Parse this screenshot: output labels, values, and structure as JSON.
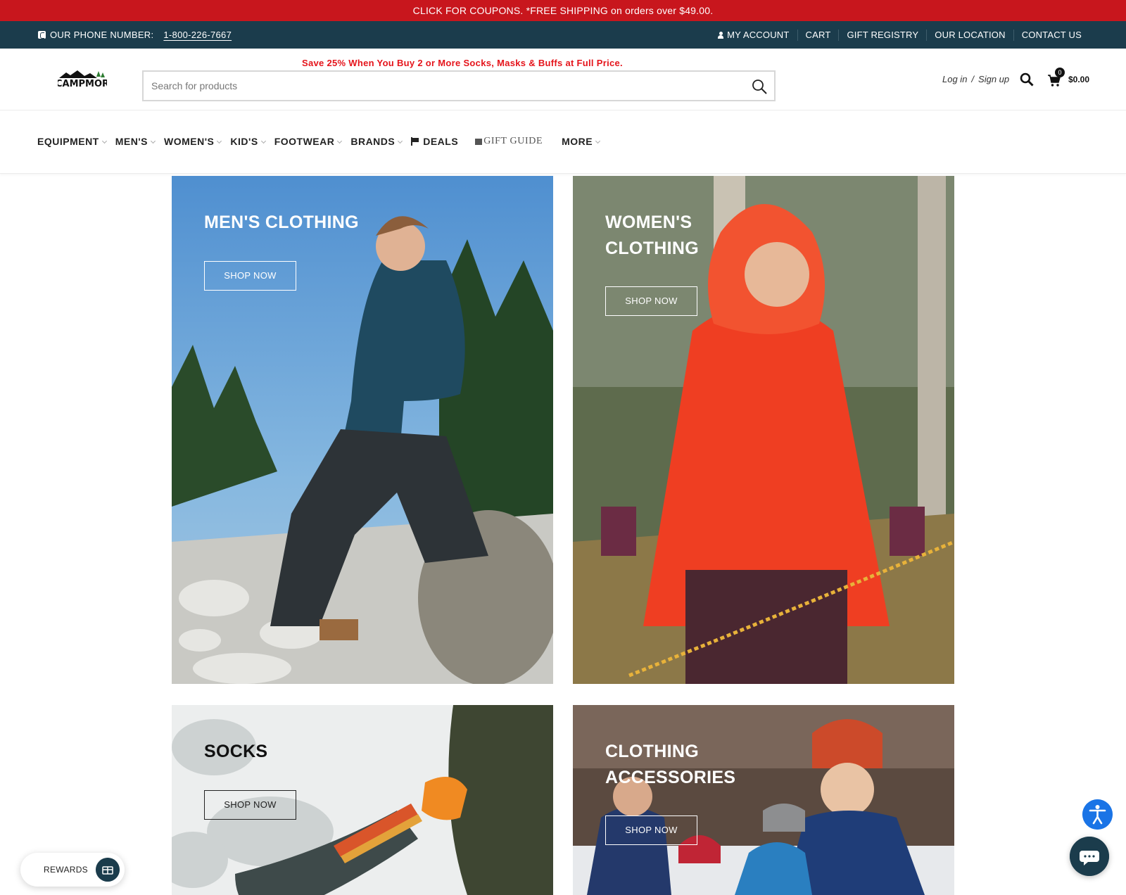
{
  "coupon_bar": {
    "text": "CLICK FOR COUPONS. *FREE SHIPPING on orders over $49.00."
  },
  "utility_bar": {
    "phone_label": "OUR PHONE NUMBER:",
    "phone_number": "1-800-226-7667",
    "links": [
      "MY ACCOUNT",
      "CART",
      "GIFT REGISTRY",
      "OUR LOCATION",
      "CONTACT US"
    ]
  },
  "header": {
    "logo_text": "CAMPMOR",
    "promo": "Save 25% When You Buy 2 or More Socks, Masks & Buffs at Full Price.",
    "search_placeholder": "Search for products",
    "login": "Log in",
    "auth_separator": "/",
    "signup": "Sign up",
    "cart_count": "0",
    "cart_total": "$0.00"
  },
  "nav": {
    "items": [
      "EQUIPMENT",
      "MEN'S",
      "WOMEN'S",
      "KID'S",
      "FOOTWEAR",
      "BRANDS",
      "DEALS",
      "GIFT GUIDE",
      "MORE"
    ]
  },
  "tiles": [
    {
      "title": "MEN'S CLOTHING",
      "button": "SHOP NOW"
    },
    {
      "title": "WOMEN'S CLOTHING",
      "button": "SHOP NOW"
    },
    {
      "title": "SOCKS",
      "button": "SHOP NOW"
    },
    {
      "title": "CLOTHING ACCESSORIES",
      "button": "SHOP NOW"
    }
  ],
  "widgets": {
    "rewards_label": "REWARDS"
  },
  "colors": {
    "coupon_red": "#c8161d",
    "utility_navy": "#1b3c4c",
    "promo_red": "#e5141b",
    "accessibility_blue": "#1a74e6"
  },
  "icons": [
    "phone-icon",
    "user-icon",
    "search-icon",
    "cart-icon",
    "flag-icon",
    "gift-icon",
    "rewards-icon",
    "accessibility-icon",
    "chat-icon"
  ]
}
